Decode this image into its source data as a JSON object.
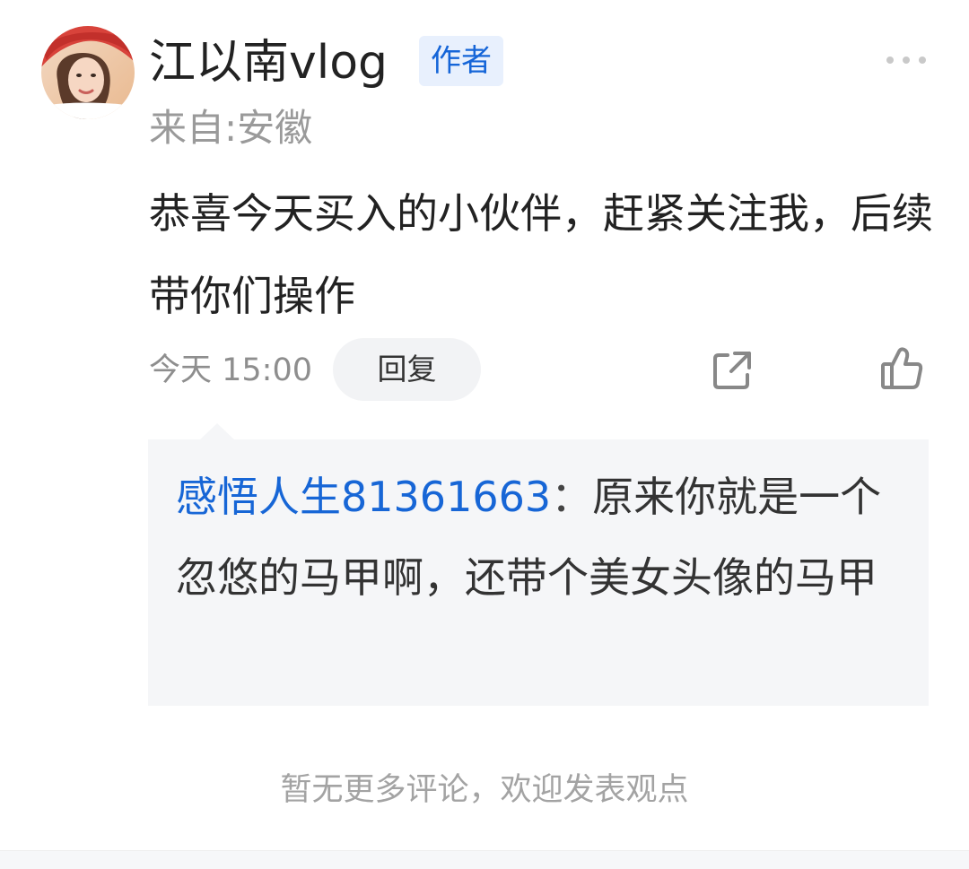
{
  "comment": {
    "author": "江以南vlog",
    "author_badge": "作者",
    "location": "来自:安徽",
    "body": "恭喜今天买入的小伙伴，赶紧关注我，后续带你们操作",
    "time": "今天 15:00",
    "reply_label": "回复",
    "icons": {
      "more": "more-dots-icon",
      "share": "share-icon",
      "like": "thumbs-up-icon"
    }
  },
  "reply": {
    "user": "感悟人生81361663",
    "separator": "：",
    "text": "原来你就是一个忽悠的马甲啊，还带个美女头像的马甲"
  },
  "footer": {
    "no_more_text": "暂无更多评论，欢迎发表观点"
  },
  "colors": {
    "link_blue": "#1766d6",
    "badge_bg": "#e8f0fd",
    "muted_gray": "#9a9a9a",
    "reply_bg": "#f5f6f8"
  }
}
